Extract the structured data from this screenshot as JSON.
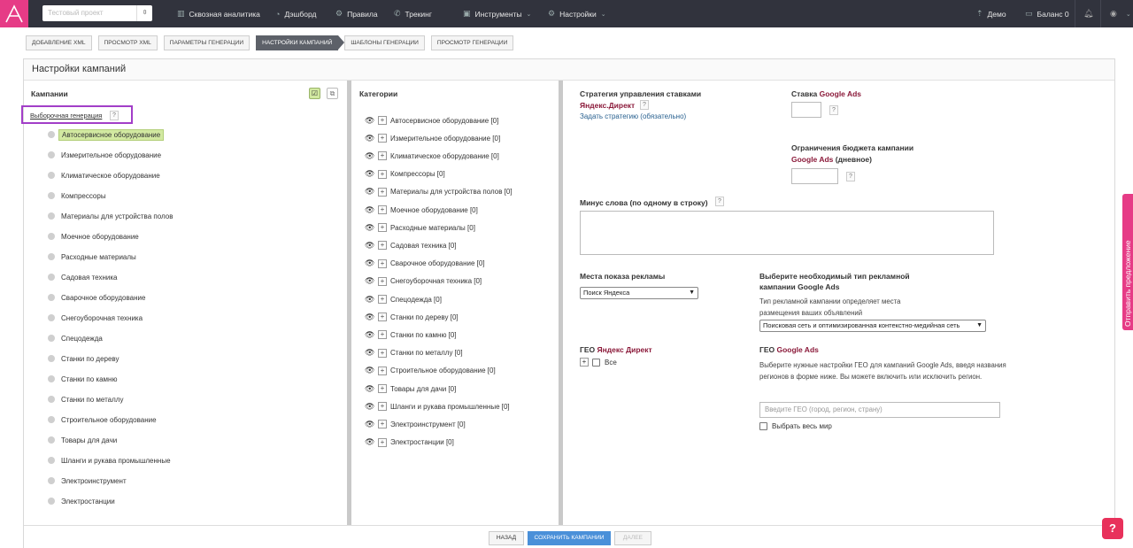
{
  "topbar": {
    "project": "Тестовый проект",
    "nav": [
      "Сквозная аналитика",
      "Дэшборд",
      "Правила",
      "Трекинг",
      "Инструменты",
      "Настройки"
    ],
    "demo": "Демо",
    "balance": "Баланс 0"
  },
  "breadcrumb": [
    "ДОБАВЛЕНИЕ XML",
    "ПРОСМОТР XML",
    "ПАРАМЕТРЫ ГЕНЕРАЦИИ",
    "НАСТРОЙКИ КАМПАНИЙ",
    "ШАБЛОНЫ ГЕНЕРАЦИИ",
    "ПРОСМОТР ГЕНЕРАЦИИ"
  ],
  "page_title": "Настройки кампаний",
  "campaigns": {
    "header": "Кампании",
    "selected_generation": "Выборочная генерация",
    "help": "?",
    "items": [
      "Автосервисное оборудование",
      "Измерительное оборудование",
      "Климатическое оборудование",
      "Компрессоры",
      "Материалы для устройства полов",
      "Моечное оборудование",
      "Расходные материалы",
      "Садовая техника",
      "Сварочное оборудование",
      "Снегоуборочная техника",
      "Спецодежда",
      "Станки по дереву",
      "Станки по камню",
      "Станки по металлу",
      "Строительное оборудование",
      "Товары для дачи",
      "Шланги и рукава промышленные",
      "Электроинструмент",
      "Электростанции"
    ]
  },
  "categories": {
    "header": "Категории",
    "items": [
      "Автосервисное оборудование [0]",
      "Измерительное оборудование [0]",
      "Климатическое оборудование [0]",
      "Компрессоры [0]",
      "Материалы для устройства полов [0]",
      "Моечное оборудование [0]",
      "Расходные материалы [0]",
      "Садовая техника [0]",
      "Сварочное оборудование [0]",
      "Снегоуборочная техника [0]",
      "Спецодежда [0]",
      "Станки по дереву [0]",
      "Станки по камню [0]",
      "Станки по металлу [0]",
      "Строительное оборудование [0]",
      "Товары для дачи [0]",
      "Шланги и рукава промышленные [0]",
      "Электроинструмент [0]",
      "Электростанции [0]"
    ]
  },
  "settings": {
    "strategy_label": "Стратегия управления ставками",
    "strategy_brand": "Яндекс.Директ",
    "strategy_link": "Задать стратегию (обязательно)",
    "bid_label": "Ставка",
    "google_ads": "Google Ads",
    "budget_label": "Ограничения бюджета кампании",
    "budget_suffix": "(дневное)",
    "minus_label": "Минус слова (по одному в строку)",
    "places_label": "Места показа рекламы",
    "places_value": "Поиск Яндекса",
    "type_label": "Выберите необходимый тип рекламной кампании Google Ads",
    "type_hint": "Тип рекламной кампании определяет места размещения ваших объявлений",
    "type_value": "Поисковая сеть и оптимизированная контекстно-медийная сеть",
    "geo_yandex_label": "ГЕО",
    "geo_yandex_brand": "Яндекс Директ",
    "geo_all": "Все",
    "geo_google_label": "ГЕО",
    "geo_google_hint": "Выберите нужные настройки ГЕО для кампаний Google Ads, введя названия регионов в форме ниже. Вы можете включить или исключить регион.",
    "geo_placeholder": "Введите ГЕО (город, регион, страну)",
    "whole_world": "Выбрать весь мир",
    "help": "?"
  },
  "footer": {
    "back": "НАЗАД",
    "save": "СОХРАНИТЬ КАМПАНИИ",
    "next": "ДАЛЕЕ"
  },
  "side_tab": "Отправить предложение",
  "colors": {
    "accent": "#e63b86",
    "topbar": "#31333d",
    "highlight": "#d2e9a1",
    "save": "#4a90d9"
  }
}
